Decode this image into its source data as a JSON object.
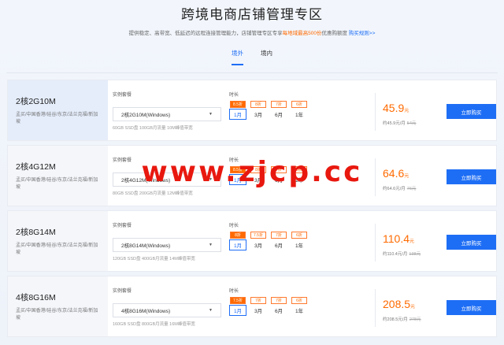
{
  "header": {
    "title": "跨境电商店铺管理专区",
    "subtitle_pre": "提供稳定、高带宽、低延迟的远程连接管理能力，店铺管理专区专享",
    "subtitle_highlight": "每地域最高500份",
    "subtitle_post": "优惠购额度",
    "subtitle_link": "购买规则>>"
  },
  "tabs": [
    {
      "label": "境外",
      "active": true
    },
    {
      "label": "境内",
      "active": false
    }
  ],
  "labels": {
    "config": "实例套餐",
    "duration": "时长",
    "buy": "立即购买",
    "price_unit": "元",
    "per_month_prefix": "约",
    "per_month_suffix": "元/月"
  },
  "plans": [
    {
      "name": "2核2G10M",
      "regions": "孟买/中国香港/硅谷/东京/法兰克福/新加坡",
      "selected": "2核2G10M(Windows)",
      "spec": "60GB SSD盘 100GB月流量 10M峰值带宽",
      "discounts": [
        "8.5折",
        "8折",
        "7折",
        "6折"
      ],
      "active_discount": 0,
      "durations": [
        "1月",
        "3月",
        "6月",
        "1年"
      ],
      "active_duration": 0,
      "price": "45.9",
      "per_month": "45.9",
      "original": "54元",
      "highlight": true
    },
    {
      "name": "2核4G12M",
      "regions": "孟买/中国香港/硅谷/东京/法兰克福/新加坡",
      "selected": "2核4G12M(Windows)",
      "spec": "80GB SSD盘 200GB月流量 12M峰值带宽",
      "discounts": [
        "8.5折",
        "8折",
        "7折",
        "6折"
      ],
      "active_discount": 0,
      "durations": [
        "1月",
        "3月",
        "6月",
        "1年"
      ],
      "active_duration": 0,
      "price": "64.6",
      "per_month": "64.6",
      "original": "76元",
      "highlight": false
    },
    {
      "name": "2核8G14M",
      "regions": "孟买/中国香港/硅谷/东京/法兰克福/新加坡",
      "selected": "2核8G14M(Windows)",
      "spec": "120GB SSD盘 400GB月流量 14M峰值带宽",
      "discounts": [
        "8折",
        "7.5折",
        "7折",
        "6折"
      ],
      "active_discount": 0,
      "durations": [
        "1月",
        "3月",
        "6月",
        "1年"
      ],
      "active_duration": 0,
      "price": "110.4",
      "per_month": "110.4",
      "original": "138元",
      "highlight": false
    },
    {
      "name": "4核8G16M",
      "regions": "孟买/中国香港/硅谷/东京/法兰克福/新加坡",
      "selected": "4核8G16M(Windows)",
      "spec": "160GB SSD盘 800GB月流量 16M峰值带宽",
      "discounts": [
        "7.5折",
        "7折",
        "7折",
        "6折"
      ],
      "active_discount": 0,
      "durations": [
        "1月",
        "3月",
        "6月",
        "1年"
      ],
      "active_duration": 0,
      "price": "208.5",
      "per_month": "208.5",
      "original": "278元",
      "highlight": false
    }
  ],
  "watermark": "www.zjcp.cc",
  "colors": {
    "accent": "#1e6ef5",
    "price": "#ff6a00",
    "watermark": "#e8180f"
  }
}
